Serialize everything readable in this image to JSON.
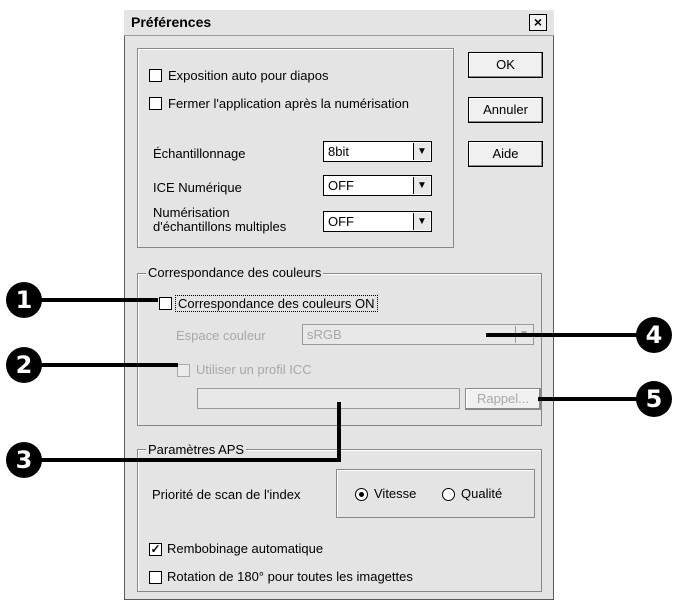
{
  "dialog": {
    "title": "Préférences",
    "close_glyph": "×",
    "buttons": {
      "ok": "OK",
      "cancel": "Annuler",
      "help": "Aide"
    }
  },
  "general": {
    "auto_exposure": {
      "label": "Exposition auto pour diapos",
      "checked": false
    },
    "close_after_scan": {
      "label": "Fermer l'application après la numérisation",
      "checked": false
    },
    "sampling": {
      "label": "Échantillonnage",
      "value": "8bit"
    },
    "ice": {
      "label": "ICE Numérique",
      "value": "OFF"
    },
    "multi_sample": {
      "label_line1": "Numérisation",
      "label_line2": "d'échantillons multiples",
      "value": "OFF"
    }
  },
  "color_matching": {
    "group_label": "Correspondance des couleurs",
    "enable": {
      "label": "Correspondance des couleurs ON",
      "checked": false
    },
    "color_space": {
      "label": "Espace couleur",
      "value": "sRGB"
    },
    "use_icc": {
      "label": "Utiliser un profil ICC",
      "checked": false
    },
    "recall_button": "Rappel..."
  },
  "aps": {
    "group_label": "Paramètres APS",
    "index_priority_label": "Priorité de scan de l'index",
    "speed": {
      "label": "Vitesse",
      "selected": true
    },
    "quality": {
      "label": "Qualité",
      "selected": false
    },
    "auto_rewind": {
      "label": "Rembobinage automatique",
      "checked": true
    },
    "rotate": {
      "label": "Rotation de 180° pour toutes les imagettes",
      "checked": false
    }
  },
  "callouts": [
    "1",
    "2",
    "3",
    "4",
    "5"
  ],
  "check_glyph": "✓"
}
